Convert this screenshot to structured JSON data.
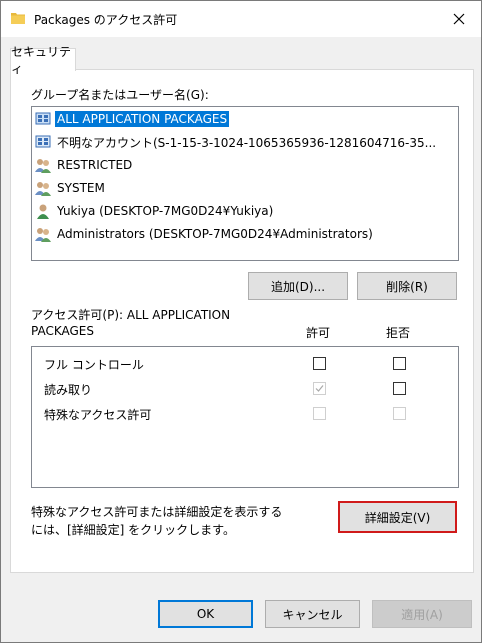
{
  "window": {
    "title": "Packages のアクセス許可"
  },
  "tab": {
    "label": "セキュリティ"
  },
  "group_section": {
    "label": "グループ名またはユーザー名(G):",
    "items": [
      {
        "name": "ALL APPLICATION PACKAGES",
        "icon": "package-group-icon",
        "selected": true
      },
      {
        "name": "不明なアカウント(S-1-15-3-1024-1065365936-1281604716-35...",
        "icon": "unknown-account-icon",
        "selected": false
      },
      {
        "name": "RESTRICTED",
        "icon": "group-icon",
        "selected": false
      },
      {
        "name": "SYSTEM",
        "icon": "group-icon",
        "selected": false
      },
      {
        "name": "Yukiya (DESKTOP-7MG0D24¥Yukiya)",
        "icon": "user-icon",
        "selected": false
      },
      {
        "name": "Administrators (DESKTOP-7MG0D24¥Administrators)",
        "icon": "group-icon",
        "selected": false
      }
    ],
    "add_button": "追加(D)...",
    "remove_button": "削除(R)"
  },
  "permissions": {
    "label_line1": "アクセス許可(P): ALL APPLICATION",
    "label_line2": "PACKAGES",
    "allow_header": "許可",
    "deny_header": "拒否",
    "rows": [
      {
        "name": "フル コントロール",
        "allow": false,
        "deny": false,
        "allow_enabled": true,
        "deny_enabled": true
      },
      {
        "name": "読み取り",
        "allow": true,
        "deny": false,
        "allow_enabled": false,
        "deny_enabled": true
      },
      {
        "name": "特殊なアクセス許可",
        "allow": false,
        "deny": false,
        "allow_enabled": false,
        "deny_enabled": false
      }
    ]
  },
  "advanced": {
    "text_line1": "特殊なアクセス許可または詳細設定を表示する",
    "text_line2": "には、[詳細設定] をクリックします。",
    "button": "詳細設定(V)"
  },
  "footer": {
    "ok": "OK",
    "cancel": "キャンセル",
    "apply": "適用(A)"
  },
  "colors": {
    "selection": "#0078d7",
    "highlight_border": "#d01a1a",
    "default_button_border": "#0078d7"
  }
}
